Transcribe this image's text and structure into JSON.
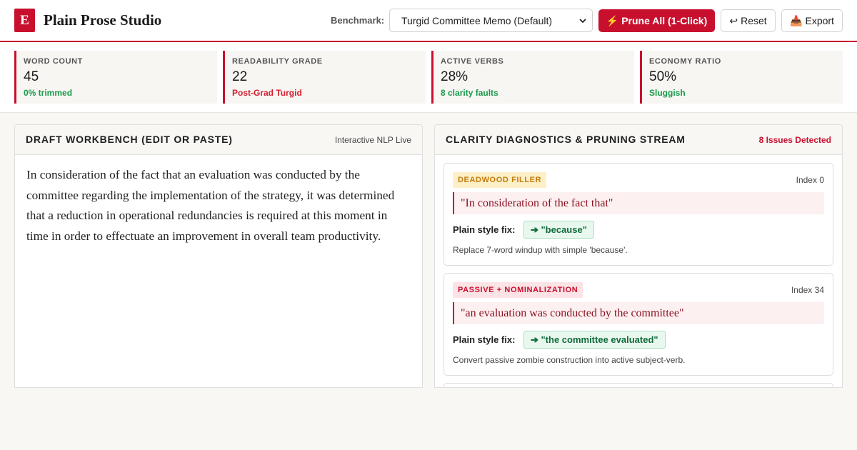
{
  "header": {
    "logo_letter": "E",
    "app_title": "Plain Prose Studio",
    "benchmark_label": "Benchmark:",
    "benchmark_value": "Turgid Committee Memo (Default)",
    "prune_icon": "lightning-icon",
    "prune_label": "Prune All (1-Click)",
    "reset_icon": "undo-arrow-icon",
    "reset_label": "Reset",
    "export_icon": "inbox-tray-icon",
    "export_label": "Export",
    "brand_color": "#c8102e"
  },
  "stats": [
    {
      "label": "WORD COUNT",
      "value": "45",
      "note": "0% trimmed",
      "note_color": "#1a9a4a"
    },
    {
      "label": "READABILITY GRADE",
      "value": "22",
      "note": "Post-Grad Turgid",
      "note_color": "#d4202f"
    },
    {
      "label": "ACTIVE VERBS",
      "value": "28%",
      "note": "8 clarity faults",
      "note_color": "#1a9a4a"
    },
    {
      "label": "ECONOMY RATIO",
      "value": "50%",
      "note": "Sluggish",
      "note_color": "#1a9a4a"
    }
  ],
  "draft": {
    "title": "DRAFT WORKBENCH (EDIT OR PASTE)",
    "meta": "Interactive NLP Live",
    "text": "In consideration of the fact that an evaluation was conducted by the committee regarding the implementation of the strategy, it was determined that a reduction in operational redundancies is required at this moment in time in order to effectuate an improvement in overall team productivity."
  },
  "diagnostics": {
    "title": "CLARITY DIAGNOSTICS & PRUNING STREAM",
    "issue_count": "8 Issues Detected",
    "fix_label": "Plain style fix:",
    "issues": [
      {
        "tag": "DEADWOOD FILLER",
        "index": "Index 0",
        "quote": "\"In consideration of the fact that\"",
        "fix": "➔ \"because\"",
        "desc": "Replace 7-word windup with simple 'because'."
      },
      {
        "tag": "PASSIVE + NOMINALIZATION",
        "index": "Index 34",
        "quote": "\"an evaluation was conducted by the committee\"",
        "fix": "➔ \"the committee evaluated\"",
        "desc": "Convert passive zombie construction into active subject-verb."
      }
    ]
  }
}
